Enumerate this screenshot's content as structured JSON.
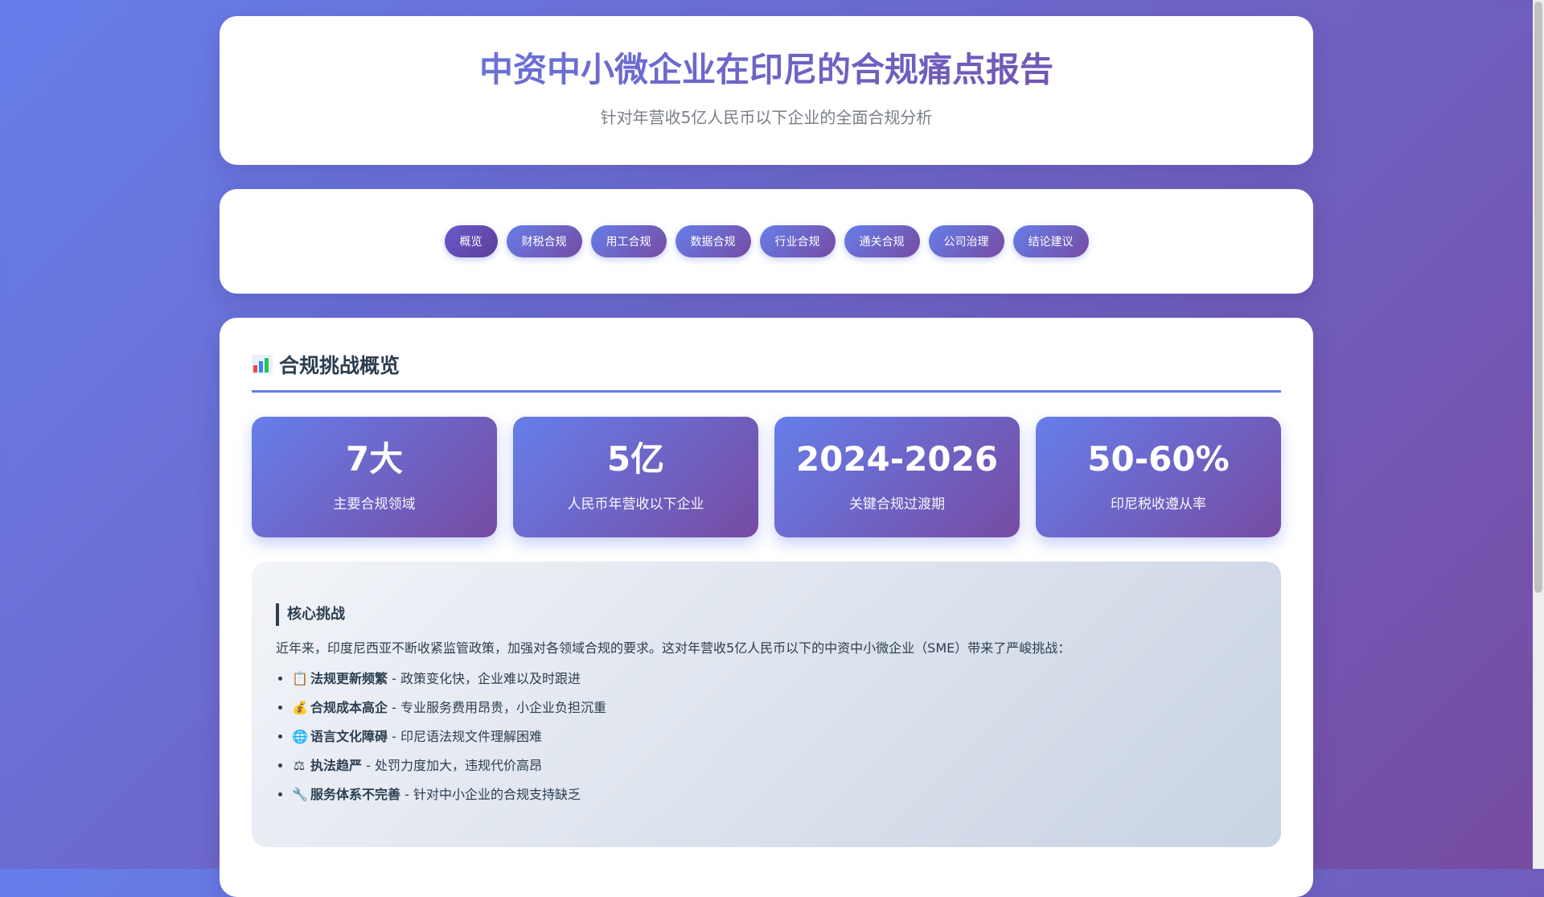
{
  "header": {
    "title": "中资中小微企业在印尼的合规痛点报告",
    "subtitle": "针对年营收5亿人民币以下企业的全面合规分析"
  },
  "nav": {
    "items": [
      {
        "label": "概览"
      },
      {
        "label": "财税合规"
      },
      {
        "label": "用工合规"
      },
      {
        "label": "数据合规"
      },
      {
        "label": "行业合规"
      },
      {
        "label": "通关合规"
      },
      {
        "label": "公司治理"
      },
      {
        "label": "结论建议"
      }
    ]
  },
  "overview": {
    "icon": "bar-chart-icon",
    "title": "合规挑战概览",
    "stats": [
      {
        "value": "7大",
        "label": "主要合规领域"
      },
      {
        "value": "5亿",
        "label": "人民币年营收以下企业"
      },
      {
        "value": "2024-2026",
        "label": "关键合规过渡期"
      },
      {
        "value": "50-60%",
        "label": "印尼税收遵从率"
      }
    ],
    "challenges": {
      "title": "核心挑战",
      "intro": "近年来，印度尼西亚不断收紧监管政策，加强对各领域合规的要求。这对年营收5亿人民币以下的中资中小微企业（SME）带来了严峻挑战：",
      "items": [
        {
          "icon": "clipboard-icon",
          "emoji": "📋",
          "title": "法规更新频繁",
          "desc": " - 政策变化快，企业难以及时跟进"
        },
        {
          "icon": "money-bag-icon",
          "emoji": "💰",
          "title": "合规成本高企",
          "desc": " - 专业服务费用昂贵，小企业负担沉重"
        },
        {
          "icon": "globe-icon",
          "emoji": "🌐",
          "title": "语言文化障碍",
          "desc": " - 印尼语法规文件理解困难"
        },
        {
          "icon": "scales-icon",
          "emoji": "⚖",
          "title": "执法趋严",
          "desc": " - 处罚力度加大，违规代价高昂"
        },
        {
          "icon": "wrench-icon",
          "emoji": "🔧",
          "title": "服务体系不完善",
          "desc": " - 针对中小企业的合规支持缺乏"
        }
      ]
    }
  },
  "colors": {
    "accent_start": "#667eea",
    "accent_end": "#764ba2",
    "text_dark": "#2c3e50"
  }
}
